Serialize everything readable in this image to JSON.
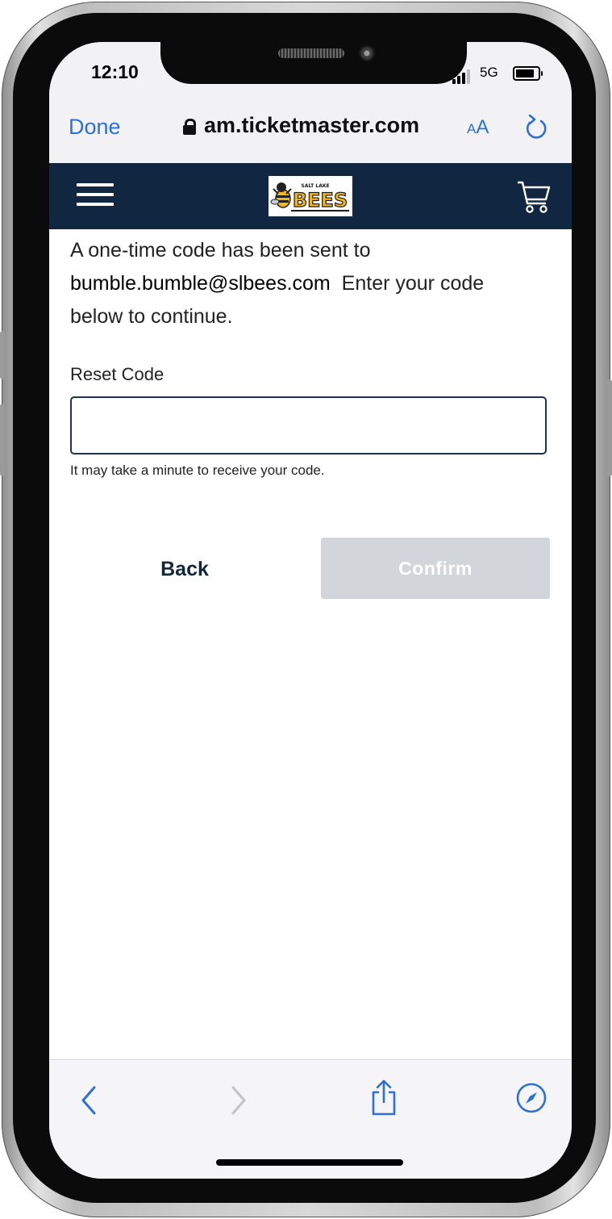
{
  "status_bar": {
    "time": "12:10",
    "network": "5G"
  },
  "browser": {
    "done_label": "Done",
    "url": "am.ticketmaster.com",
    "text_size_small": "A",
    "text_size_big": "A"
  },
  "header": {
    "logo_top": "SALT LAKE",
    "logo_main": "BEES"
  },
  "form": {
    "intro_line1": "A one-time code has been sent to",
    "email": "bumble.bumble@slbees.com",
    "intro_line2": "Enter your code",
    "intro_line3": "below to continue.",
    "reset_label": "Reset Code",
    "reset_value": "",
    "hint": "It may take a minute to receive your code.",
    "back_label": "Back",
    "confirm_label": "Confirm"
  },
  "colors": {
    "header_bg": "#112641",
    "link_blue": "#2e6fd6",
    "confirm_disabled_bg": "#d2d5da"
  },
  "icons": [
    "lock-icon",
    "reload-icon",
    "hamburger-menu-icon",
    "cart-icon",
    "back-arrow-icon",
    "forward-arrow-icon",
    "share-icon",
    "compass-icon"
  ]
}
